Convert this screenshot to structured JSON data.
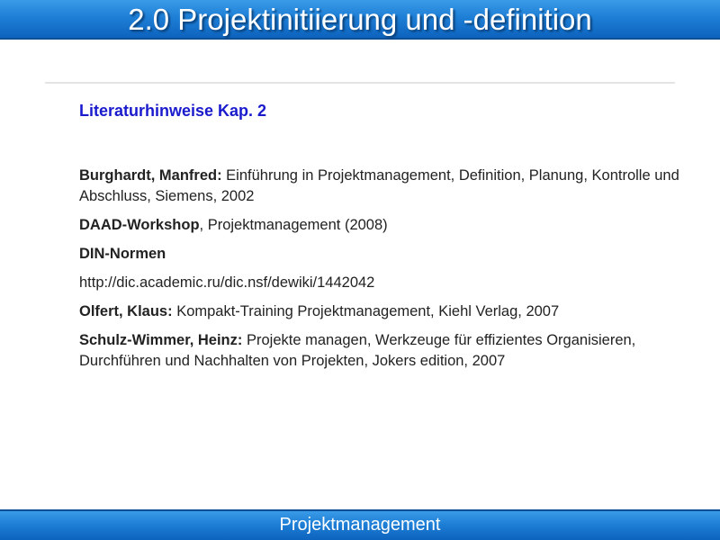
{
  "slide": {
    "title": "2.0 Projektinitiierung und -definition",
    "footer": "Projektmanagement"
  },
  "content": {
    "heading": "Literaturhinweise Kap. 2",
    "references": [
      {
        "author": "Burghardt, Manfred:",
        "text": " Einführung in Projektmanagement, Definition, Planung, Kontrolle und Abschluss, Siemens, 2002"
      },
      {
        "author": "DAAD-Workshop",
        "text": ", Projektmanagement (2008)"
      },
      {
        "author": "DIN-Normen",
        "text": ""
      },
      {
        "author": "",
        "text": "http://dic.academic.ru/dic.nsf/dewiki/1442042"
      },
      {
        "author": "Olfert, Klaus:",
        "text": " Kompakt-Training Projektmanagement, Kiehl Verlag, 2007"
      },
      {
        "author": "Schulz-Wimmer, Heinz:",
        "text": " Projekte managen, Werkzeuge für effizientes Organisieren, Durchführen und Nachhalten von Projekten, Jokers edition, 2007"
      }
    ]
  },
  "colors": {
    "title_bar": "#1e7fd6",
    "heading": "#1a1acd"
  }
}
